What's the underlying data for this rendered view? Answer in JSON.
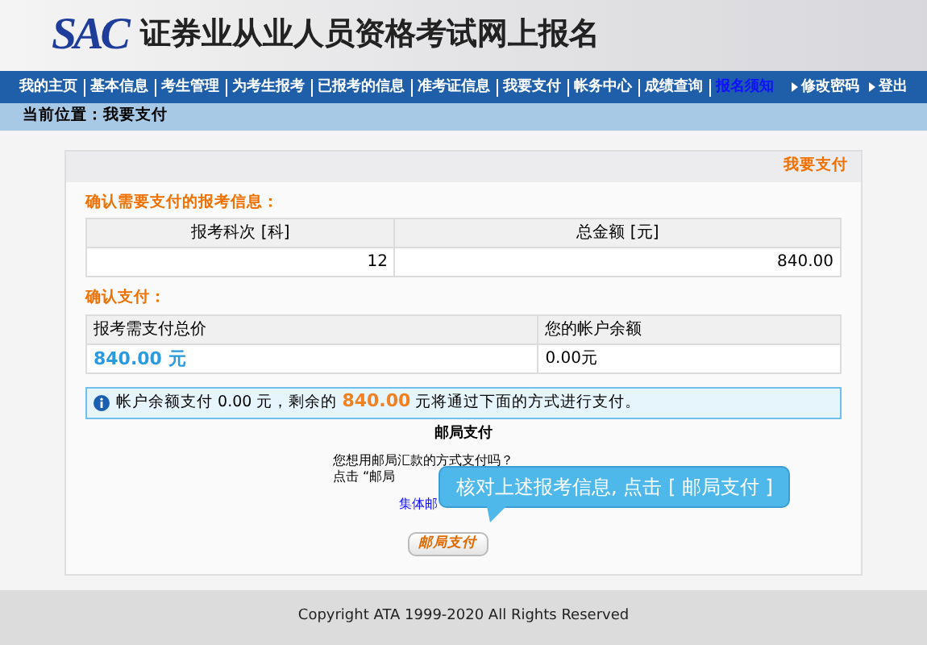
{
  "header": {
    "logo": "SAC",
    "title": "证券业从业人员资格考试网上报名"
  },
  "nav": {
    "items": [
      {
        "label": "我的主页",
        "kind": "link"
      },
      {
        "label": "基本信息",
        "kind": "link"
      },
      {
        "label": "考生管理",
        "kind": "link"
      },
      {
        "label": "为考生报考",
        "kind": "link"
      },
      {
        "label": "已报考的信息",
        "kind": "link"
      },
      {
        "label": "准考证信息",
        "kind": "link"
      },
      {
        "label": "我要支付",
        "kind": "link"
      },
      {
        "label": "帐务中心",
        "kind": "link"
      },
      {
        "label": "成绩查询",
        "kind": "link"
      },
      {
        "label": "报名须知",
        "kind": "highlight"
      }
    ],
    "right": [
      "修改密码",
      "登出"
    ]
  },
  "breadcrumb": "当前位置：我要支付",
  "panel": {
    "title": "我要支付",
    "section1": {
      "heading": "确认需要支付的报考信息：",
      "columns": [
        "报考科次 [科]",
        "总金额 [元]"
      ],
      "row": [
        "12",
        "840.00"
      ]
    },
    "section2": {
      "heading": "确认支付：",
      "columns": [
        "报考需支付总价",
        "您的帐户余额"
      ],
      "row": [
        "840.00 元",
        "0.00元"
      ]
    },
    "notice": "帐户余额支付  0.00 元，剩余的 **840.00** 元将通过下面的方式进行支付。",
    "post": {
      "heading": "邮局支付",
      "lines": [
        "您想用邮局汇款的方式支付吗？",
        "点击 “邮局"
      ],
      "link": "集体邮",
      "button": "邮局支付"
    }
  },
  "tooltip": "核对上述报考信息, 点击 [ 邮局支付 ]",
  "footer": "Copyright ATA 1999-2020 All Rights Reserved"
}
